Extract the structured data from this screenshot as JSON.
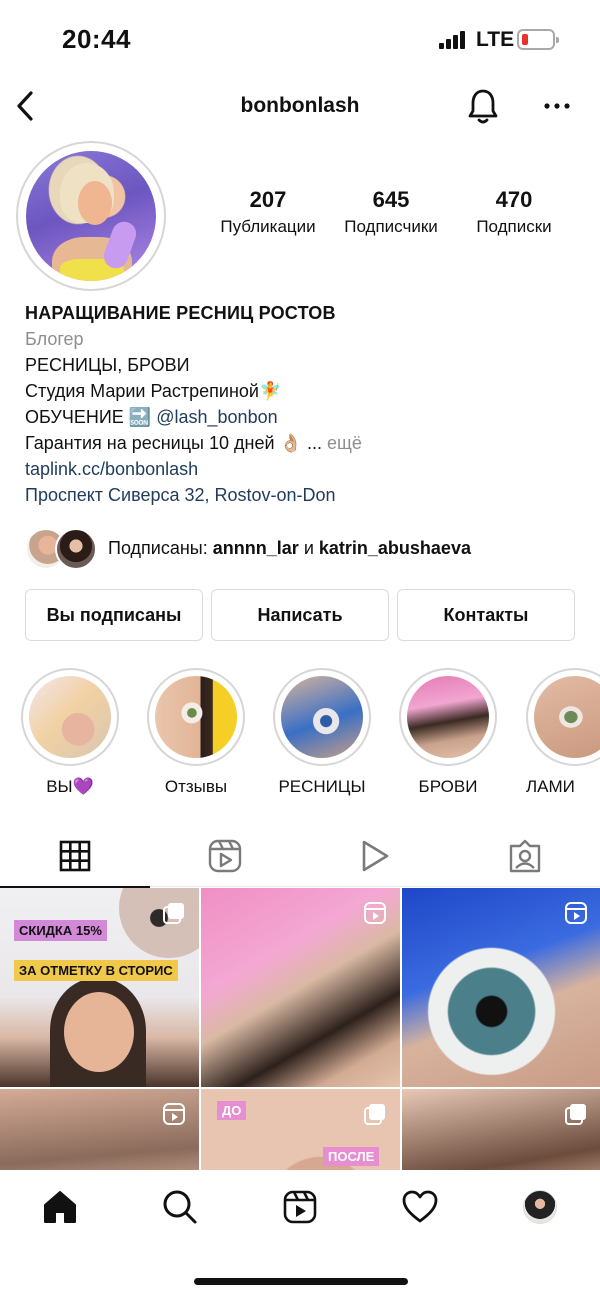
{
  "status_bar": {
    "time": "20:44",
    "network": "LTE",
    "battery_level": 0.15,
    "battery_color": "#e8322a"
  },
  "header": {
    "username": "bonbonlash",
    "icons": [
      "back-icon",
      "bell-icon",
      "more-icon"
    ]
  },
  "profile": {
    "stats": [
      {
        "value": "207",
        "label": "Публикации"
      },
      {
        "value": "645",
        "label": "Подписчики"
      },
      {
        "value": "470",
        "label": "Подписки"
      }
    ],
    "name": "НАРАЩИВАНИЕ РЕСНИЦ РОСТОВ",
    "category": "Блогер",
    "bio_lines": {
      "line1": "РЕСНИЦЫ, БРОВИ",
      "line2": "Студия Марии Растрепиной",
      "line2_emoji": "🧚",
      "line3_text": "ОБУЧЕНИЕ",
      "line3_emoji": "🔜",
      "line3_mention": "@lash_bonbon",
      "line4_text": "Гарантия на ресницы 10 дней",
      "line4_emoji": "👌🏼",
      "line4_ellipsis": "...",
      "line4_more": "ещё"
    },
    "website": "taplink.cc/bonbonlash",
    "address": "Проспект Сиверса 32, Rostov-on-Don"
  },
  "followed_by": {
    "prefix": "Подписаны:",
    "user1": "annnn_lar",
    "conj": "и",
    "user2": "katrin_abushaeva"
  },
  "buttons": {
    "following": "Вы подписаны",
    "message": "Написать",
    "contacts": "Контакты"
  },
  "highlights": [
    {
      "label": "ВЫ💜"
    },
    {
      "label": "Отзывы"
    },
    {
      "label": "РЕСНИЦЫ"
    },
    {
      "label": "БРОВИ"
    },
    {
      "label": "ЛАМИ"
    }
  ],
  "tabs": [
    "grid-icon",
    "reels-icon",
    "video-icon",
    "tagged-icon"
  ],
  "grid": {
    "post1": {
      "promo_line1": "СКИДКА 15%",
      "promo_line2": "ЗА ОТМЕТКУ В СТОРИС"
    },
    "post5": {
      "before": "ДО",
      "after": "ПОСЛЕ"
    }
  },
  "bottom_nav": [
    "home-icon",
    "search-icon",
    "reels-icon",
    "heart-icon",
    "profile-avatar"
  ]
}
